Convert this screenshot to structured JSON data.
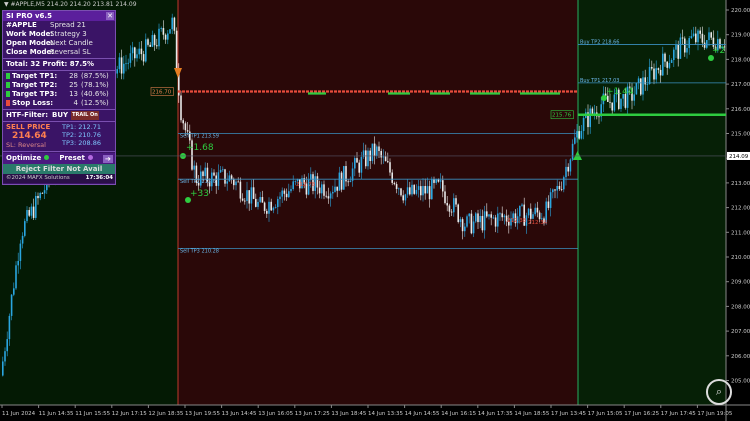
{
  "symbol_line": "▼ #APPLE,M5  214.20 214.20 213.81 214.09",
  "panel": {
    "title": "SI PRO v6.5",
    "close": "✕",
    "symbol": "#APPLE",
    "spread_label": "Spread",
    "spread": "21",
    "rows": [
      {
        "k": "Work Mode:",
        "v": "Strategy 3"
      },
      {
        "k": "Open Mode:",
        "v": "Next Candle"
      },
      {
        "k": "Close Mode:",
        "v": "Reversal SL"
      }
    ],
    "total": "Total: 32  Profit: 87.5%",
    "targets": [
      {
        "k": "Target TP1:",
        "n": "28",
        "pc": "(87.5%)",
        "color": "#2ecc40"
      },
      {
        "k": "Target TP2:",
        "n": "25",
        "pc": "(78.1%)",
        "color": "#2ecc40"
      },
      {
        "k": "Target TP3:",
        "n": "13",
        "pc": "(40.6%)",
        "color": "#2ecc40"
      },
      {
        "k": "Stop Loss:",
        "n": "4",
        "pc": "(12.5%)",
        "color": "#e74c3c"
      }
    ],
    "htf_label": "HTF-Filter:",
    "htf_value": "BUY",
    "trail": "TRAIL On",
    "sell_title": "SELL PRICE",
    "sell_price": "214.64",
    "sl_text": "SL: Reversal",
    "tp_lines": [
      "TP1: 212.71",
      "TP2: 210.76",
      "TP3: 208.86"
    ],
    "optimize": "Optimize",
    "preset": "Preset",
    "arrow": "➔",
    "reject": "Reject Filter Not Avail",
    "copyright": "©2024 MAFX Solutions",
    "clock": "17:36:04"
  },
  "price_axis": [
    "220.00",
    "219.00",
    "218.00",
    "217.00",
    "216.00",
    "215.00",
    "214.00",
    "213.00",
    "212.00",
    "211.00",
    "210.00",
    "209.00",
    "208.00",
    "207.00",
    "206.00",
    "205.00"
  ],
  "highlight_price": "214.09",
  "time_axis": [
    "11 Jun 2024",
    "11 Jun 14:35",
    "11 Jun 15:55",
    "12 Jun 17:15",
    "12 Jun 18:35",
    "13 Jun 19:55",
    "13 Jun 14:45",
    "13 Jun 16:05",
    "13 Jun 17:25",
    "13 Jun 18:45",
    "14 Jun 13:35",
    "14 Jun 14:55",
    "14 Jun 16:15",
    "14 Jun 17:35",
    "14 Jun 18:55",
    "17 Jun 13:45",
    "17 Jun 15:05",
    "17 Jun 16:25",
    "17 Jun 17:45",
    "17 Jun 19:05"
  ],
  "labels": {
    "sell_entry": "216.70",
    "tp1": "Sell TP1 213.59",
    "tp2": "Sell TP2 213.6",
    "tp3": "Sell TP3 210.28",
    "buy_entry": "215.76",
    "buy_tp1": "Buy TP1 217.03",
    "buy_tp2": "Buy TP2 218.66",
    "gain1": "+1.68",
    "gain2": "+33",
    "gain3": "+1.44",
    "gain4": "+2",
    "mark1": "212.78",
    "mark2": "212.38",
    "mark3": "212.34"
  },
  "colors": {
    "sell_zone": "#2a0808",
    "buy_zone": "#062006",
    "pre_zone": "#041a04",
    "up": "#2aa6e0",
    "down": "#e9e9e9",
    "sell_line": "#e74c3c",
    "buy_line": "#2ecc40",
    "tp_line": "#3a8fc0"
  }
}
